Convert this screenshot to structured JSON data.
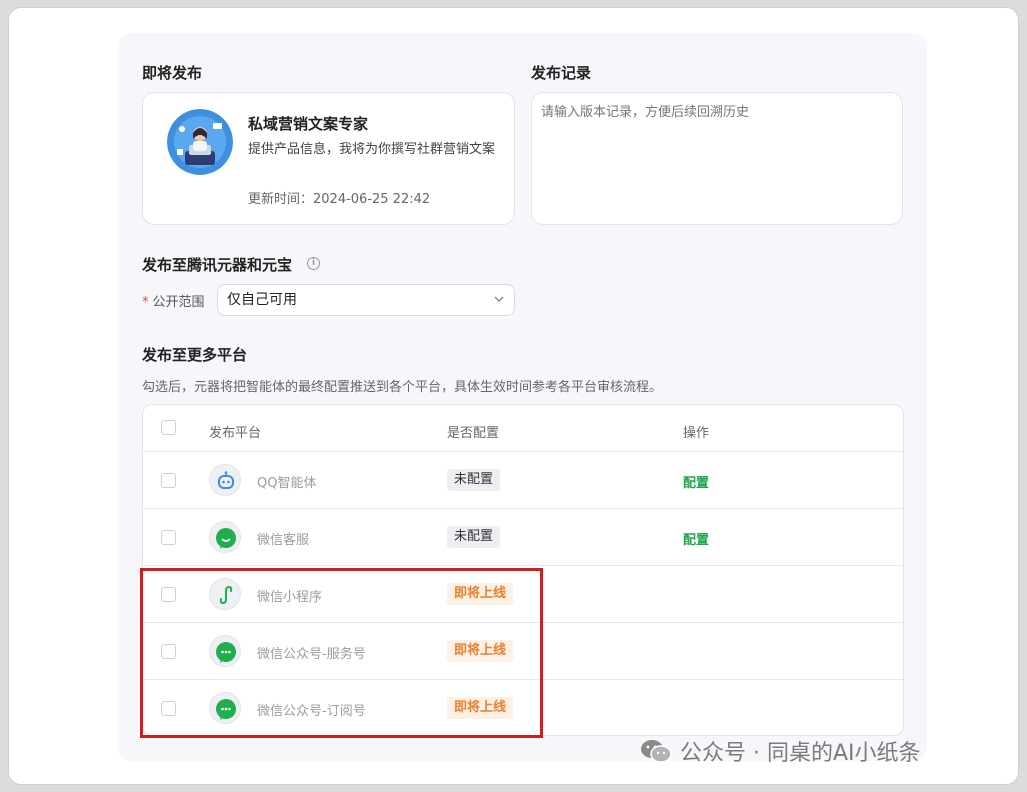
{
  "publish": {
    "title": "即将发布",
    "bot": {
      "name": "私域营销文案专家",
      "description": "提供产品信息，我将为你撰写社群营销文案",
      "updated": "更新时间：2024-06-25 22:42"
    }
  },
  "record": {
    "title": "发布记录",
    "placeholder": "请输入版本记录，方便后续回溯历史"
  },
  "tencent": {
    "title": "发布至腾讯元器和元宝",
    "scope_label": "公开范围",
    "scope_value": "仅自己可用"
  },
  "more": {
    "title": "发布至更多平台",
    "hint": "勾选后，元器将把智能体的最终配置推送到各个平台，具体生效时间参考各平台审核流程。"
  },
  "table": {
    "headers": [
      "发布平台",
      "是否配置",
      "操作"
    ],
    "rows": [
      {
        "name": "QQ智能体",
        "status": "未配置",
        "status_type": "gray",
        "action": "配置",
        "icon": "qq-bot-icon"
      },
      {
        "name": "微信客服",
        "status": "未配置",
        "status_type": "gray",
        "action": "配置",
        "icon": "wechat-icon"
      },
      {
        "name": "微信小程序",
        "status": "即将上线",
        "status_type": "orange",
        "action": "",
        "icon": "mini-program-icon"
      },
      {
        "name": "微信公众号-服务号",
        "status": "即将上线",
        "status_type": "orange",
        "action": "",
        "icon": "wechat-icon"
      },
      {
        "name": "微信公众号-订阅号",
        "status": "即将上线",
        "status_type": "orange",
        "action": "",
        "icon": "wechat-icon"
      }
    ]
  },
  "watermark": "公众号 · 同桌的AI小纸条",
  "colors": {
    "accent_green": "#1fa64f",
    "orange": "#e8802e",
    "highlight_red": "#d31d1d"
  }
}
